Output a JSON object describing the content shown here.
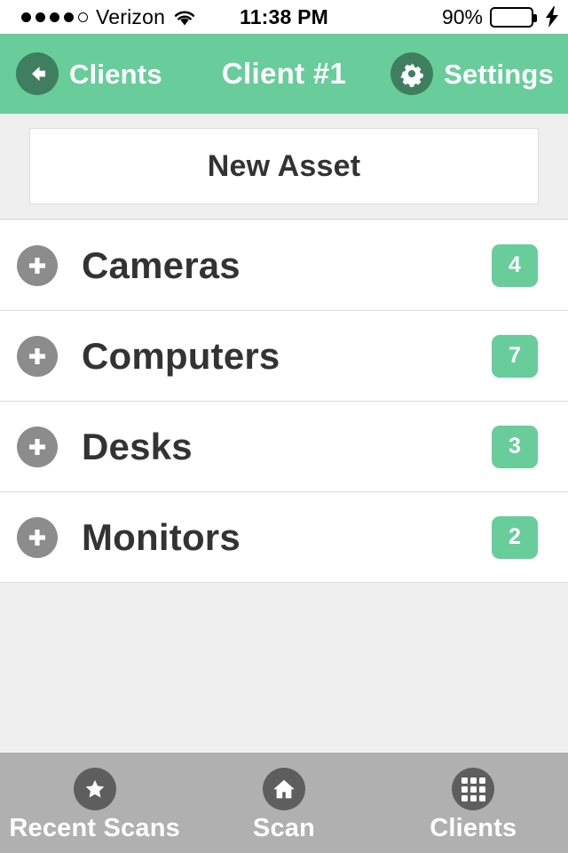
{
  "status_bar": {
    "signal_dots_total": 5,
    "signal_dots_filled": 4,
    "carrier": "Verizon",
    "wifi_icon": "wifi-icon",
    "time": "11:38 PM",
    "battery_percent": "90%",
    "battery_level": 90,
    "charging_icon": "lightning-bolt-icon"
  },
  "nav_bar": {
    "back_label": "Clients",
    "back_icon": "arrow-left-icon",
    "title": "Client #1",
    "settings_label": "Settings",
    "settings_icon": "gear-icon",
    "background_color": "#68cd9a",
    "icon_circle_color": "#3f7f5f"
  },
  "header": {
    "new_asset_label": "New Asset"
  },
  "list": {
    "add_icon": "plus-circle-icon",
    "badge_color": "#68cd9a",
    "items": [
      {
        "label": "Cameras",
        "count": "4"
      },
      {
        "label": "Computers",
        "count": "7"
      },
      {
        "label": "Desks",
        "count": "3"
      },
      {
        "label": "Monitors",
        "count": "2"
      }
    ]
  },
  "tab_bar": {
    "background_color": "#b0b0b0",
    "tabs": [
      {
        "label": "Recent Scans",
        "icon": "star-icon"
      },
      {
        "label": "Scan",
        "icon": "home-icon"
      },
      {
        "label": "Clients",
        "icon": "grid-icon"
      }
    ]
  }
}
